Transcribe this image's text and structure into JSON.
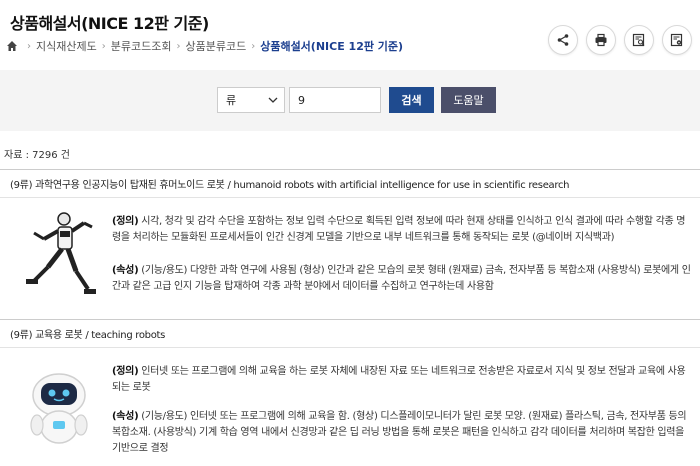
{
  "page_title": "상품해설서(NICE 12판 기준)",
  "breadcrumb": {
    "items": [
      "지식재산제도",
      "분류코드조회",
      "상품분류코드"
    ],
    "current": "상품해설서(NICE 12판 기준)"
  },
  "search": {
    "select_value": "류",
    "input_value": "9",
    "search_label": "검색",
    "help_label": "도움말"
  },
  "result_count": "자료 : 7296 건",
  "items": [
    {
      "class_label": "(9류)",
      "title": "과학연구용 인공지능이 탑재된 휴머노이드 로봇 / humanoid robots with artificial intelligence for use in scientific research",
      "def_label": "(정의)",
      "def_text": "시각, 청각 및 감각 수단을 포함하는 정보 입력 수단으로 획득된 입력 정보에 따라 현재 상태를 인식하고 인식 결과에 따라 수행할 각종 명령을 처리하는 모듈화된 프로세서들이 인간 신경계 모델을 기반으로 내부 네트워크를 통해 동작되는 로봇 (@네이버 지식백과)",
      "attr_label": "(속성)",
      "attr_text": "(기능/용도) 다양한 과학 연구에 사용됨 (형상) 인간과 같은 모습의 로봇 형태 (원재료) 금속, 전자부품 등 복합소재 (사용방식) 로봇에게 인간과 같은 고급 인지 기능을 탑재하여 각종 과학 분야에서 데이터를 수집하고 연구하는데 사용함"
    },
    {
      "class_label": "(9류)",
      "title": "교육용 로봇 / teaching robots",
      "def_label": "(정의)",
      "def_text": "인터넷 또는 프로그램에 의해 교육을 하는 로봇 자체에 내장된 자료 또는 네트워크로 전송받은 자료로서 지식 및 정보 전달과 교육에 사용되는 로봇",
      "attr_label": "(속성)",
      "attr_text": "(기능/용도) 인터넷 또는 프로그램에 의해 교육을 함. (형상) 디스플레이모니터가 달린 로봇 모양. (원재료) 플라스틱, 금속, 전자부품 등의 복합소재. (사용방식) 기계 학습 영역 내에서 신경망과 같은 딥 러닝 방법을 통해 로봇은 패턴을 인식하고 감각 데이터를 처리하며 복잡한 입력을 기반으로 결정"
    }
  ],
  "icons": {
    "home": "home-icon",
    "share": "share-icon",
    "print": "print-icon",
    "view1": "document-search-icon",
    "view2": "document-settings-icon"
  }
}
